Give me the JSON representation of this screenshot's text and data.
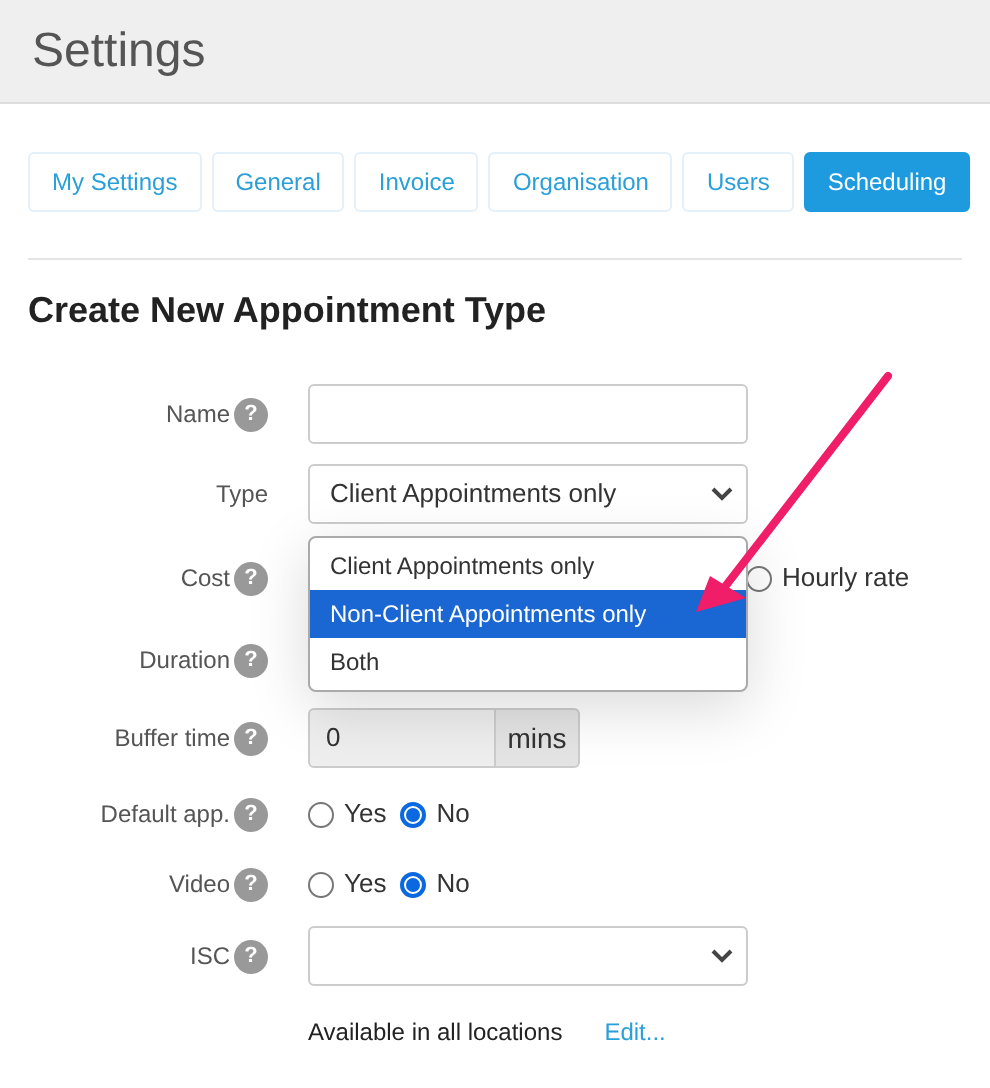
{
  "header": {
    "title": "Settings"
  },
  "tabs": [
    {
      "label": "My Settings",
      "selected": false
    },
    {
      "label": "General",
      "selected": false
    },
    {
      "label": "Invoice",
      "selected": false
    },
    {
      "label": "Organisation",
      "selected": false
    },
    {
      "label": "Users",
      "selected": false
    },
    {
      "label": "Scheduling",
      "selected": true
    }
  ],
  "heading": "Create New Appointment Type",
  "fields": [
    {
      "kind": "text",
      "label": "Name",
      "help": "?"
    },
    {
      "kind": "select",
      "label": "Type",
      "value": "Client Appointments only"
    },
    {
      "kind": "radios",
      "label": "Cost",
      "help": "?",
      "options": [
        {
          "label": "Hourly rate",
          "selected": false
        }
      ]
    },
    {
      "kind": "addon",
      "label": "Duration",
      "help": "?"
    },
    {
      "kind": "addon",
      "label": "Buffer time",
      "help": "?",
      "value": "0",
      "addon": "mins"
    },
    {
      "kind": "radios",
      "label": "Default app.",
      "help": "?",
      "options": [
        {
          "label": "Yes",
          "selected": false
        },
        {
          "label": "No",
          "selected": true
        }
      ]
    },
    {
      "kind": "radios",
      "label": "Video",
      "help": "?",
      "options": [
        {
          "label": "Yes",
          "selected": false
        },
        {
          "label": "No",
          "selected": true
        }
      ]
    },
    {
      "kind": "select",
      "label": "ISC",
      "help": "?"
    },
    {
      "kind": "note",
      "text": "Available in all locations",
      "link": "Edit..."
    }
  ],
  "dropdown": {
    "options": [
      {
        "label": "Client Appointments only",
        "selected": false
      },
      {
        "label": "Non-Client Appointments only",
        "selected": true
      },
      {
        "label": "Both",
        "selected": false
      }
    ]
  }
}
